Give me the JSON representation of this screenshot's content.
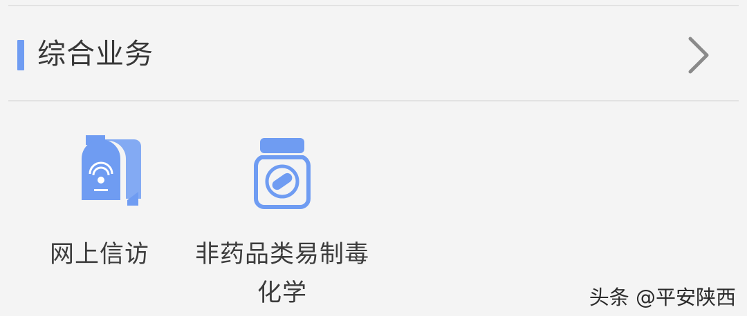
{
  "section": {
    "title": "综合业务"
  },
  "items": [
    {
      "label": "网上信访",
      "icon": "mailbox-icon"
    },
    {
      "label": "非药品类易制毒化学",
      "icon": "medicine-jar-icon"
    }
  ],
  "watermark": "头条 @平安陕西",
  "colors": {
    "accent": "#6f9cf2",
    "background": "#f4f4f4",
    "divider": "#e2e2e2",
    "chevron": "#8a8a8a"
  }
}
